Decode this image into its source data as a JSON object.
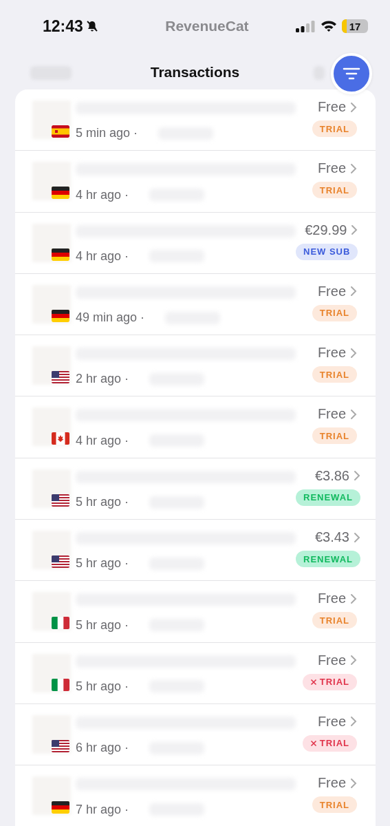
{
  "status_bar": {
    "time": "12:43",
    "logo": "RevenueCat",
    "battery": "17"
  },
  "header": {
    "title": "Transactions"
  },
  "transactions": [
    {
      "flag": {
        "kind": "es"
      },
      "time": "5 min ago ·",
      "price": "Free",
      "badge": {
        "kind": "trial",
        "label": "TRIAL"
      }
    },
    {
      "flag": {
        "kind": "de"
      },
      "time": "4 hr ago ·",
      "price": "Free",
      "badge": {
        "kind": "trial",
        "label": "TRIAL"
      }
    },
    {
      "flag": {
        "kind": "de"
      },
      "time": "4 hr ago ·",
      "price": "€29.99",
      "badge": {
        "kind": "new_sub",
        "label": "NEW SUB"
      }
    },
    {
      "flag": {
        "kind": "de"
      },
      "time": "49 min ago ·",
      "price": "Free",
      "badge": {
        "kind": "trial",
        "label": "TRIAL"
      }
    },
    {
      "flag": {
        "kind": "us"
      },
      "time": "2 hr ago ·",
      "price": "Free",
      "badge": {
        "kind": "trial",
        "label": "TRIAL"
      }
    },
    {
      "flag": {
        "kind": "ca"
      },
      "time": "4 hr ago ·",
      "price": "Free",
      "badge": {
        "kind": "trial",
        "label": "TRIAL"
      }
    },
    {
      "flag": {
        "kind": "us"
      },
      "time": "5 hr ago ·",
      "price": "€3.86",
      "badge": {
        "kind": "renewal",
        "label": "RENEWAL"
      }
    },
    {
      "flag": {
        "kind": "us"
      },
      "time": "5 hr ago ·",
      "price": "€3.43",
      "badge": {
        "kind": "renewal",
        "label": "RENEWAL"
      }
    },
    {
      "flag": {
        "kind": "it"
      },
      "time": "5 hr ago ·",
      "price": "Free",
      "badge": {
        "kind": "trial",
        "label": "TRIAL"
      }
    },
    {
      "flag": {
        "kind": "it"
      },
      "time": "5 hr ago ·",
      "price": "Free",
      "badge": {
        "kind": "cancelled_trial",
        "label": "TRIAL"
      }
    },
    {
      "flag": {
        "kind": "us"
      },
      "time": "6 hr ago ·",
      "price": "Free",
      "badge": {
        "kind": "cancelled_trial",
        "label": "TRIAL"
      }
    },
    {
      "flag": {
        "kind": "de"
      },
      "time": "7 hr ago ·",
      "price": "Free",
      "badge": {
        "kind": "trial",
        "label": "TRIAL"
      }
    }
  ]
}
